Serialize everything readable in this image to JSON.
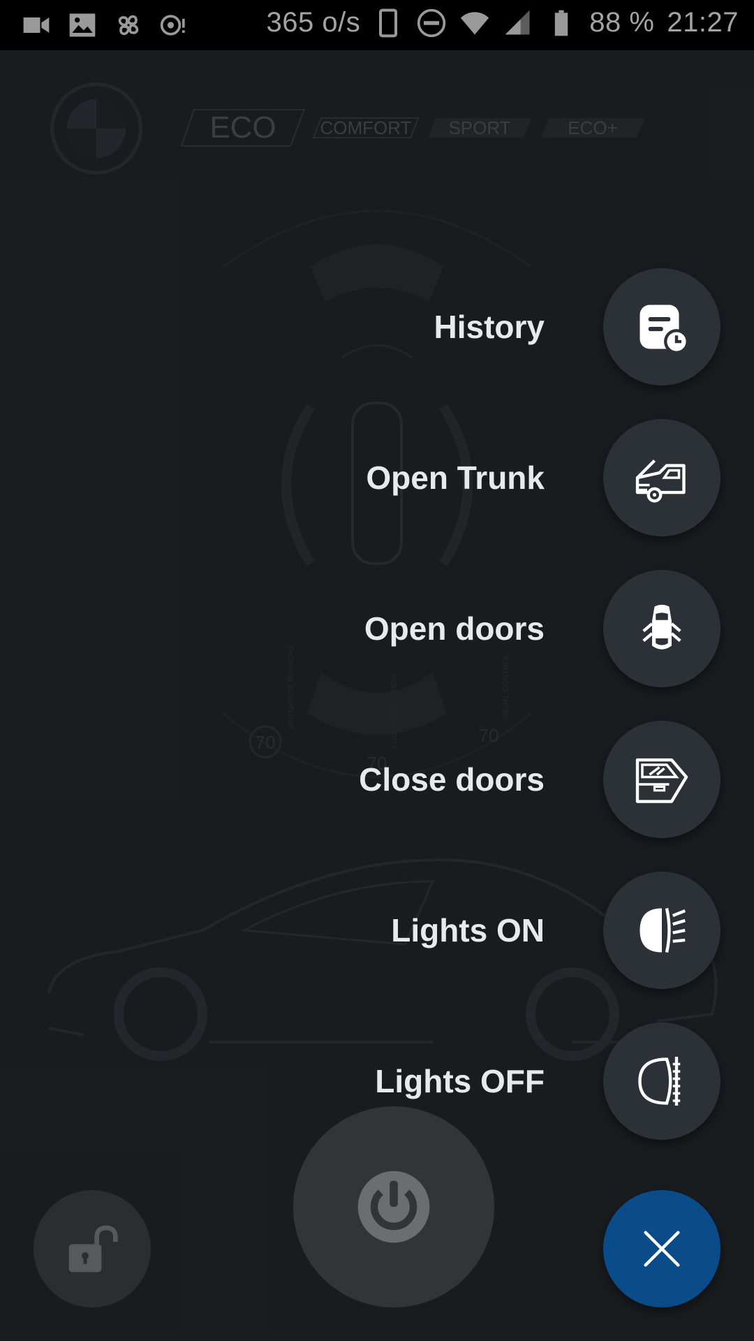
{
  "status_bar": {
    "speed": "365 o/s",
    "battery": "88 %",
    "time": "21:27",
    "icons": [
      "video-icon",
      "image-icon",
      "fan-icon",
      "sensor-icon",
      "phone-icon",
      "dnd-icon",
      "wifi-icon",
      "signal-icon",
      "battery-icon"
    ]
  },
  "background": {
    "drive_modes": [
      "ECO",
      "COMFORT",
      "SPORT",
      "ECO+"
    ],
    "sensor_labels": [
      "AUTOPILOT SENSORS",
      "FULL ANGLE VISION",
      "VISUAL CONTROL"
    ],
    "sensor_values": [
      "70",
      "70",
      "70"
    ]
  },
  "menu": {
    "items": [
      {
        "label": "History",
        "icon": "history-icon"
      },
      {
        "label": "Open Trunk",
        "icon": "trunk-icon"
      },
      {
        "label": "Open doors",
        "icon": "open-doors-icon"
      },
      {
        "label": "Close doors",
        "icon": "close-doors-icon"
      },
      {
        "label": "Lights ON",
        "icon": "lights-on-icon"
      },
      {
        "label": "Lights OFF",
        "icon": "lights-off-icon"
      }
    ]
  },
  "bottom": {
    "unlock_icon": "unlock-icon",
    "power_icon": "power-icon",
    "close_icon": "close-icon"
  },
  "colors": {
    "background": "#1d1f22",
    "fab": "#2c3138",
    "accent": "#0a4b8a",
    "label": "#e7eaed"
  }
}
